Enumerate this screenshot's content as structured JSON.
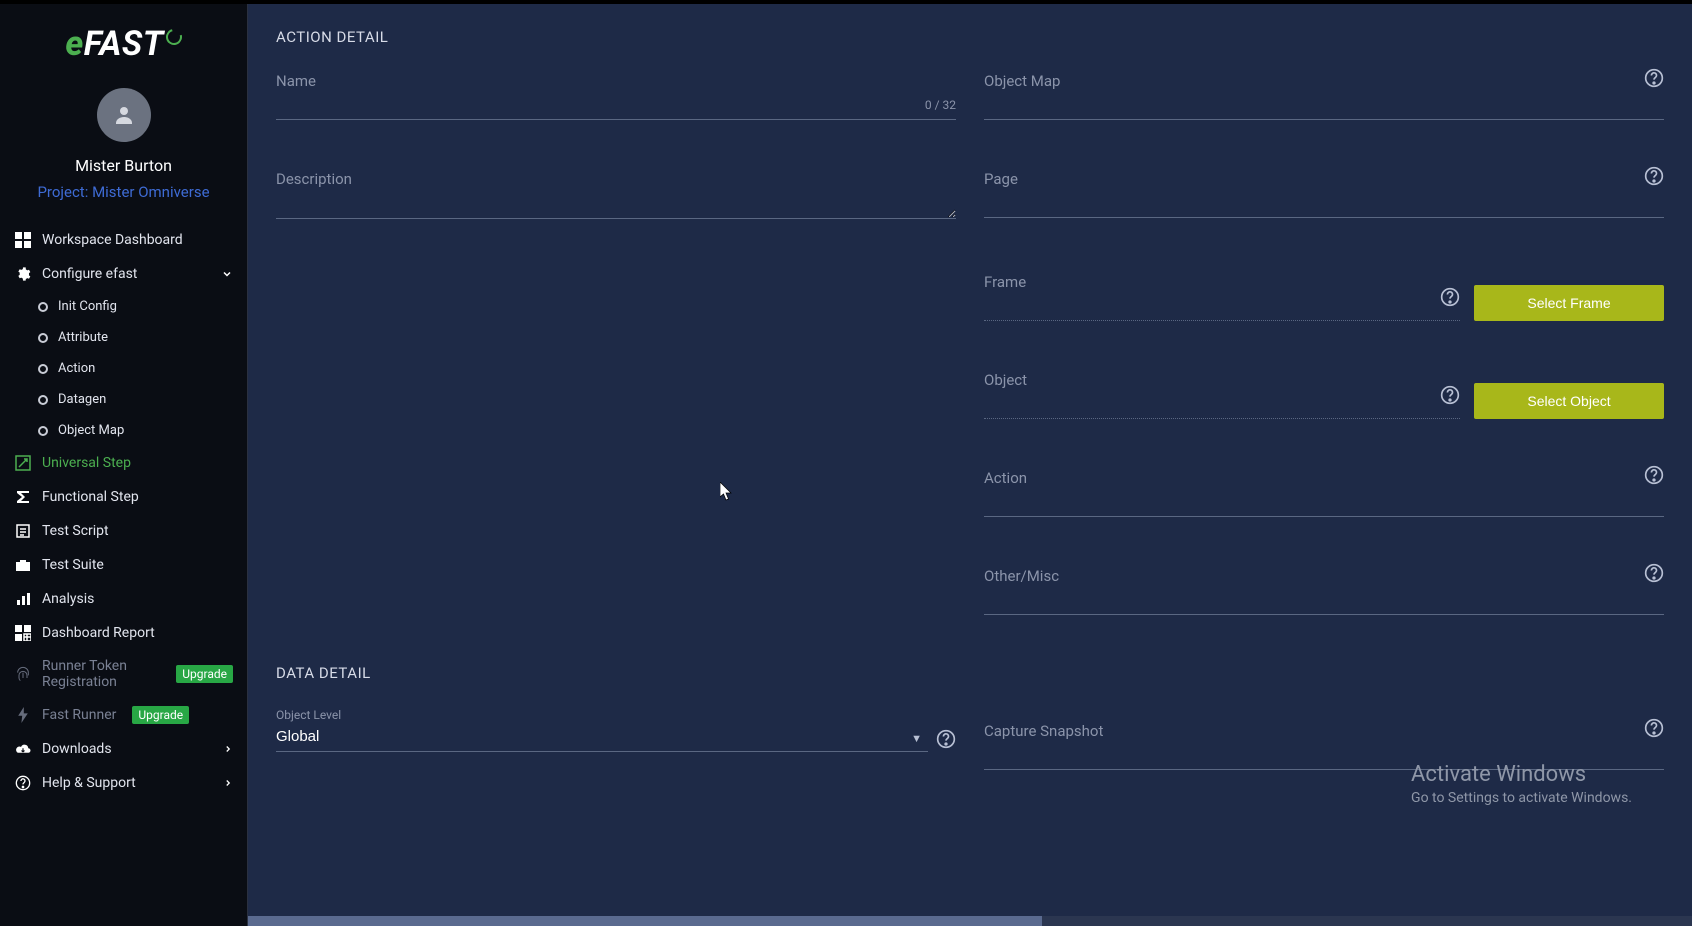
{
  "brand": {
    "name": "eFAST"
  },
  "user": {
    "name": "Mister Burton",
    "project_label": "Project: Mister Omniverse"
  },
  "sidebar": {
    "items": [
      {
        "label": "Workspace Dashboard"
      },
      {
        "label": "Configure efast"
      },
      {
        "label": "Init Config"
      },
      {
        "label": "Attribute"
      },
      {
        "label": "Action"
      },
      {
        "label": "Datagen"
      },
      {
        "label": "Object Map"
      },
      {
        "label": "Universal Step"
      },
      {
        "label": "Functional Step"
      },
      {
        "label": "Test Script"
      },
      {
        "label": "Test Suite"
      },
      {
        "label": "Analysis"
      },
      {
        "label": "Dashboard Report"
      },
      {
        "label": "Runner Token Registration"
      },
      {
        "label": "Fast Runner"
      },
      {
        "label": "Downloads"
      },
      {
        "label": "Help & Support"
      }
    ],
    "upgrade_badge": "Upgrade"
  },
  "main": {
    "section_action": "ACTION DETAIL",
    "section_data": "DATA DETAIL",
    "name_label": "Name",
    "name_counter": "0 / 32",
    "description_label": "Description",
    "object_map_label": "Object Map",
    "page_label": "Page",
    "frame_label": "Frame",
    "select_frame_btn": "Select Frame",
    "object_label": "Object",
    "select_object_btn": "Select Object",
    "action_label": "Action",
    "other_label": "Other/Misc",
    "object_level_label": "Object Level",
    "object_level_value": "Global",
    "capture_snapshot_label": "Capture Snapshot"
  },
  "watermark": {
    "l1": "Activate Windows",
    "l2": "Go to Settings to activate Windows."
  }
}
